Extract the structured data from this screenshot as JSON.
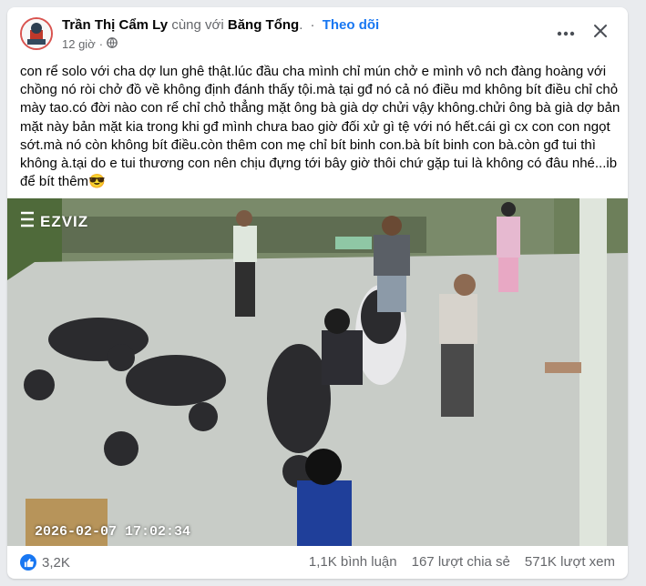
{
  "post": {
    "author": "Trần Thị Cẩm Ly",
    "with_text": "cùng với",
    "tagged": "Băng Tổng",
    "follow_label": "Theo dõi",
    "time": "12 giờ",
    "text": "con rể solo với cha dợ lun ghê thật.lúc đầu cha mình chỉ mún chở e mình vô nch đàng hoàng với chồng nó ròi chở đồ về không định đánh thấy tội.mà tại gđ nó cả nó điều md không bít điều chỉ chỏ mày tao.có đời nào con rể chỉ chỏ thẳng mặt ông bà già dợ chửi vậy không.chửi ông bà già dợ bản mặt này bản mặt kia trong khi gđ mình chưa bao giờ đối xử gì tệ với nó hết.cái gì cx con con ngọt sớt.mà nó còn không bít điều.còn thêm con mẹ chỉ bít binh con.bà bít binh con bà.còn gđ tui thì không à.tại do e tui thương con nên chịu đựng tới bây giờ thôi chứ gặp tui là không có đâu nhé...ib để bít thêm😎"
  },
  "media": {
    "camera_brand": "EZVIZ",
    "timestamp": "2026-02-07 17:02:34"
  },
  "footer": {
    "reactions_count": "3,2K",
    "comments": "1,1K bình luận",
    "shares": "167 lượt chia sẻ",
    "views": "571K lượt xem"
  },
  "icons": {
    "more": "more-horizontal-icon",
    "close": "close-icon",
    "audience": "globe-icon",
    "like": "like-icon"
  },
  "colors": {
    "accent": "#1877f2",
    "text_primary": "#050505",
    "text_secondary": "#65676b"
  }
}
